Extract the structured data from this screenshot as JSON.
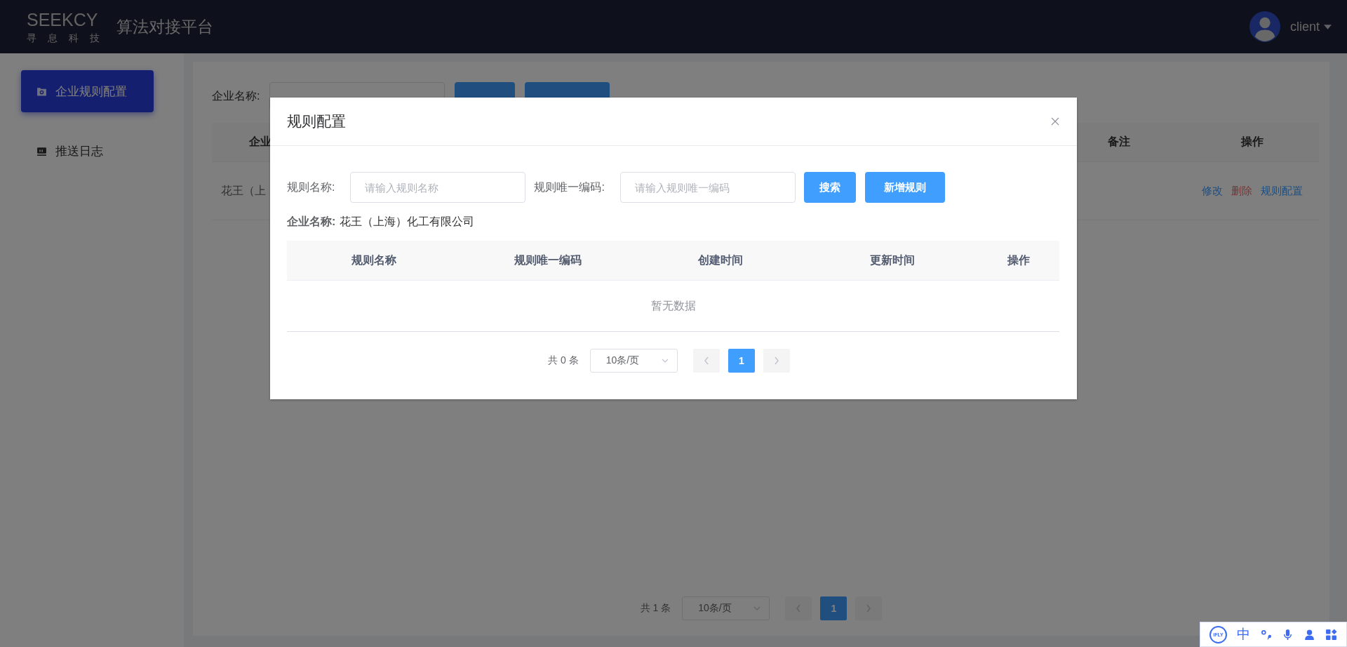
{
  "header": {
    "wordmark": "SEEKCY",
    "tagline": "寻 息 科 技",
    "title": "算法对接平台",
    "user": "client"
  },
  "sidebar": {
    "items": [
      {
        "label": "企业规则配置",
        "selected": true,
        "kind": "settings"
      },
      {
        "label": "推送日志",
        "selected": false,
        "kind": "log"
      }
    ]
  },
  "search": {
    "label": "企业名称:"
  },
  "table": {
    "columns": [
      "企业",
      "备注",
      "操作"
    ],
    "rows": [
      {
        "name": "花王（上",
        "actions": [
          {
            "label": "修改",
            "kind": "link"
          },
          {
            "label": "删除",
            "kind": "danger"
          },
          {
            "label": "规则配置",
            "kind": "link"
          }
        ]
      }
    ]
  },
  "pagination": {
    "total": "共 1 条",
    "page_size": "10条/页",
    "pages": [
      {
        "label": "1",
        "selected": true
      }
    ]
  },
  "dialog": {
    "title": "规则配置",
    "filters": [
      {
        "label": "规则名称:",
        "placeholder": "请输入规则名称"
      },
      {
        "label": "规则唯一编码:",
        "placeholder": "请输入规则唯一编码"
      }
    ],
    "buttons": [
      "搜索",
      "新增规则"
    ],
    "company": {
      "label": "企业名称:",
      "value": "花王（上海）化工有限公司"
    },
    "table": {
      "columns": [
        "规则名称",
        "规则唯一编码",
        "创建时间",
        "更新时间",
        "操作"
      ],
      "empty_text": "暂无数据"
    },
    "pagination": {
      "total": "共 0 条",
      "page_size": "10条/页",
      "pages": [
        {
          "label": "1",
          "selected": true
        }
      ]
    }
  },
  "ime_bar": {
    "logo": "iFLY",
    "mode": "中"
  }
}
